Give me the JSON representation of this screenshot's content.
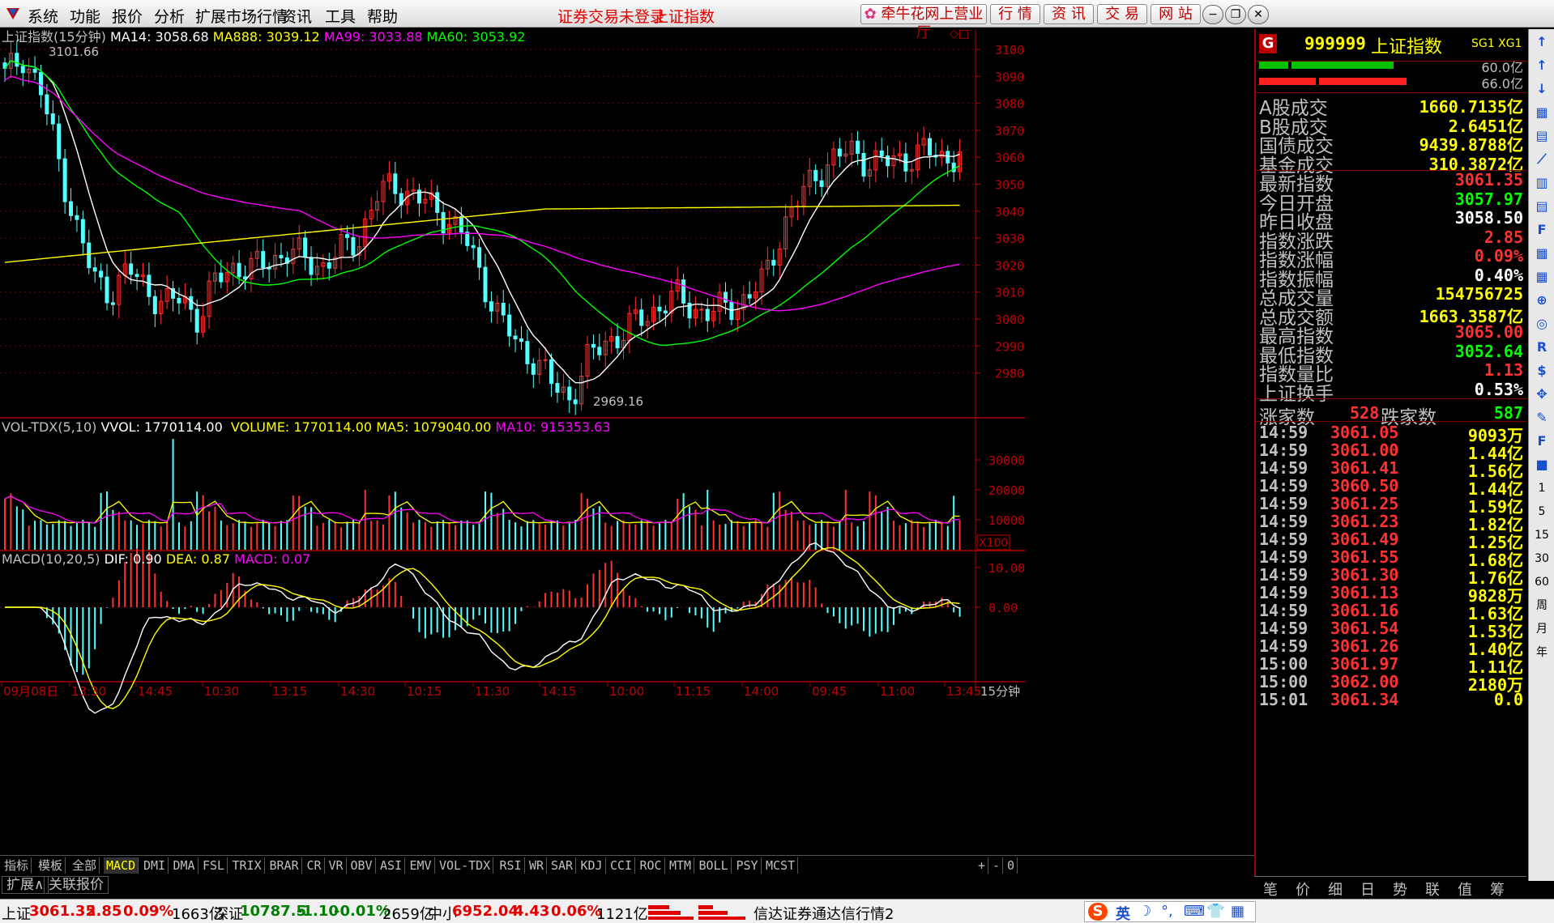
{
  "menubar": {
    "items": [
      "系统",
      "功能",
      "报价",
      "分析",
      "扩展市场行情",
      "资讯",
      "工具",
      "帮助"
    ],
    "status_title": "证券交易未登录",
    "index_title": "上证指数",
    "broker_button": "牵牛花网上营业厅",
    "tool_buttons": [
      "行 情",
      "资 讯",
      "交 易",
      "网 站"
    ]
  },
  "main_chart": {
    "legend_title": "上证指数(15分钟)",
    "ma14": "MA14: 3058.68",
    "ma888": "MA888: 3039.12",
    "ma99": "MA99: 3033.88",
    "ma60": "MA60: 3053.92",
    "high_marker": "3101.66",
    "low_marker": "2969.16",
    "y_ticks": [
      "3100",
      "3090",
      "3080",
      "3070",
      "3060",
      "3050",
      "3040",
      "3030",
      "3020",
      "3010",
      "3000",
      "2990",
      "2980"
    ],
    "colors": {
      "up": "#ff3232",
      "down": "#54ffff",
      "ma14": "#ffffff",
      "ma888": "#ffff00",
      "ma99": "#ff00ff",
      "ma60": "#00ff00",
      "axis": "#b00000"
    }
  },
  "volume_chart": {
    "legend_name": "VOL-TDX(5,10)",
    "vvol": "VVOL: 1770114.00",
    "volume": "VOLUME: 1770114.00",
    "ma5": "MA5: 1079040.00",
    "ma10": "MA10: 915353.63",
    "y_ticks": [
      "30000",
      "20000",
      "10000"
    ],
    "unit": "X100"
  },
  "macd_chart": {
    "legend_name": "MACD(10,20,5)",
    "dif": "DIF: 0.90",
    "dea": "DEA: 0.87",
    "macd": "MACD: 0.07",
    "y_ticks": [
      "10.00",
      "0.00"
    ]
  },
  "time_axis": {
    "labels": [
      "09月08日",
      "13:30",
      "14:45",
      "10:30",
      "13:15",
      "14:30",
      "10:15",
      "11:30",
      "14:15",
      "10:00",
      "11:15",
      "14:00",
      "09:45",
      "11:00",
      "13:45"
    ],
    "period": "15分钟"
  },
  "indicator_tabs": [
    "指标",
    "模板",
    "全部",
    "MACD",
    "DMI",
    "DMA",
    "FSL",
    "TRIX",
    "BRAR",
    "CR",
    "VR",
    "OBV",
    "ASI",
    "EMV",
    "VOL-TDX",
    "RSI",
    "WR",
    "SAR",
    "KDJ",
    "CCI",
    "ROC",
    "MTM",
    "BOLL",
    "PSY",
    "MCST"
  ],
  "bottom_tabs": [
    "扩展∧",
    "关联报价"
  ],
  "tab_controls": [
    "+",
    "-",
    "0"
  ],
  "quote_panel": {
    "badge": "G",
    "code": "999999",
    "name": "上证指数",
    "tag": "SG1 XG1",
    "bar_values": [
      "60.0亿",
      "66.0亿"
    ],
    "turnover": [
      {
        "label": "A股成交",
        "value": "1660.7135亿"
      },
      {
        "label": "B股成交",
        "value": "2.6451亿"
      },
      {
        "label": "国债成交",
        "value": "9439.8788亿"
      },
      {
        "label": "基金成交",
        "value": "310.3872亿"
      }
    ],
    "stats": [
      {
        "label": "最新指数",
        "value": "3061.35",
        "color": "#ff3232"
      },
      {
        "label": "今日开盘",
        "value": "3057.97",
        "color": "#00ff00"
      },
      {
        "label": "昨日收盘",
        "value": "3058.50",
        "color": "#ffffff"
      },
      {
        "label": "指数涨跌",
        "value": "2.85",
        "color": "#ff3232"
      },
      {
        "label": "指数涨幅",
        "value": "0.09%",
        "color": "#ff3232"
      },
      {
        "label": "指数振幅",
        "value": "0.40%",
        "color": "#ffffff"
      },
      {
        "label": "总成交量",
        "value": "154756725",
        "color": "#ffff00"
      },
      {
        "label": "总成交额",
        "value": "1663.3587亿",
        "color": "#ffff00"
      },
      {
        "label": "最高指数",
        "value": "3065.00",
        "color": "#ff3232"
      },
      {
        "label": "最低指数",
        "value": "3052.64",
        "color": "#00ff00"
      },
      {
        "label": "指数量比",
        "value": "1.13",
        "color": "#ff3232"
      },
      {
        "label": "上证换手",
        "value": "0.53%",
        "color": "#ffffff"
      }
    ],
    "up_label": "涨家数",
    "up_count": "528",
    "down_label": "跌家数",
    "down_count": "587",
    "ticks": [
      {
        "time": "14:59",
        "price": "3061.05",
        "vol": "9093万"
      },
      {
        "time": "14:59",
        "price": "3061.00",
        "vol": "1.44亿"
      },
      {
        "time": "14:59",
        "price": "3061.41",
        "vol": "1.56亿"
      },
      {
        "time": "14:59",
        "price": "3060.50",
        "vol": "1.44亿"
      },
      {
        "time": "14:59",
        "price": "3061.25",
        "vol": "1.59亿"
      },
      {
        "time": "14:59",
        "price": "3061.23",
        "vol": "1.82亿"
      },
      {
        "time": "14:59",
        "price": "3061.49",
        "vol": "1.25亿"
      },
      {
        "time": "14:59",
        "price": "3061.55",
        "vol": "1.68亿"
      },
      {
        "time": "14:59",
        "price": "3061.30",
        "vol": "1.76亿"
      },
      {
        "time": "14:59",
        "price": "3061.13",
        "vol": "9828万"
      },
      {
        "time": "14:59",
        "price": "3061.16",
        "vol": "1.63亿"
      },
      {
        "time": "14:59",
        "price": "3061.54",
        "vol": "1.53亿"
      },
      {
        "time": "14:59",
        "price": "3061.26",
        "vol": "1.40亿"
      },
      {
        "time": "15:00",
        "price": "3061.97",
        "vol": "1.11亿"
      },
      {
        "time": "15:00",
        "price": "3062.00",
        "vol": "2180万"
      },
      {
        "time": "15:01",
        "price": "3061.34",
        "vol": "0.0"
      }
    ],
    "bottom_tabs": [
      "笔",
      "价",
      "细",
      "日",
      "势",
      "联",
      "值",
      "筹"
    ]
  },
  "icon_bar": [
    "↑",
    "↑",
    "↓",
    "▦",
    "▤",
    "⟋",
    "▥",
    "▤",
    "F",
    "▦",
    "▦",
    "⊕",
    "◎",
    "R",
    "$",
    "✥",
    "✎",
    "F",
    "■",
    "1",
    "5",
    "15",
    "30",
    "60",
    "周",
    "月",
    "年"
  ],
  "statusbar": {
    "sh_name": "上证",
    "sh_price": "3061.35",
    "sh_change": "2.85",
    "sh_pct": "0.09%",
    "sh_amount": "1663亿",
    "sz_name": "深证",
    "sz_price": "10787.5",
    "sz_change": "-1.10",
    "sz_pct": "-0.01%",
    "sz_amount": "2659亿",
    "zx_name": "中小",
    "zx_price": "6952.04",
    "zx_change": "4.43",
    "zx_pct": "0.06%",
    "zx_amount": "1121亿",
    "server": "信达证券通达信行情2",
    "ime": "英"
  }
}
